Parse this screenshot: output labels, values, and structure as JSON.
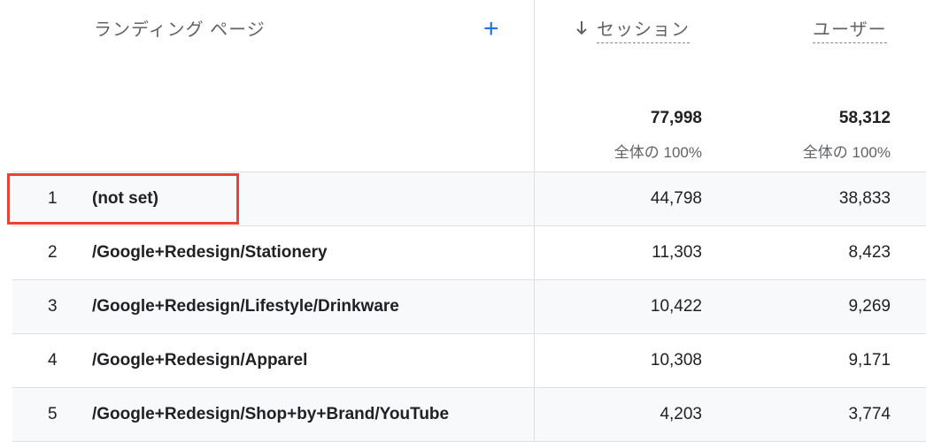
{
  "header": {
    "dimension_label": "ランディング ページ",
    "add_icon": "plus-icon",
    "sort_icon": "arrow-down-icon",
    "metric_sessions": "セッション",
    "metric_users": "ユーザー"
  },
  "totals": {
    "sessions": "77,998",
    "sessions_pct": "全体の 100%",
    "users": "58,312",
    "users_pct": "全体の 100%"
  },
  "rows": [
    {
      "rank": "1",
      "page": "(not set)",
      "sessions": "44,798",
      "users": "38,833"
    },
    {
      "rank": "2",
      "page": "/Google+Redesign/Stationery",
      "sessions": "11,303",
      "users": "8,423"
    },
    {
      "rank": "3",
      "page": "/Google+Redesign/Lifestyle/Drinkware",
      "sessions": "10,422",
      "users": "9,269"
    },
    {
      "rank": "4",
      "page": "/Google+Redesign/Apparel",
      "sessions": "10,308",
      "users": "9,171"
    },
    {
      "rank": "5",
      "page": "/Google+Redesign/Shop+by+Brand/YouTube",
      "sessions": "4,203",
      "users": "3,774"
    }
  ],
  "colors": {
    "accent": "#1a73e8",
    "highlight": "#ea4335",
    "row_shade": "#f8f9fa"
  }
}
